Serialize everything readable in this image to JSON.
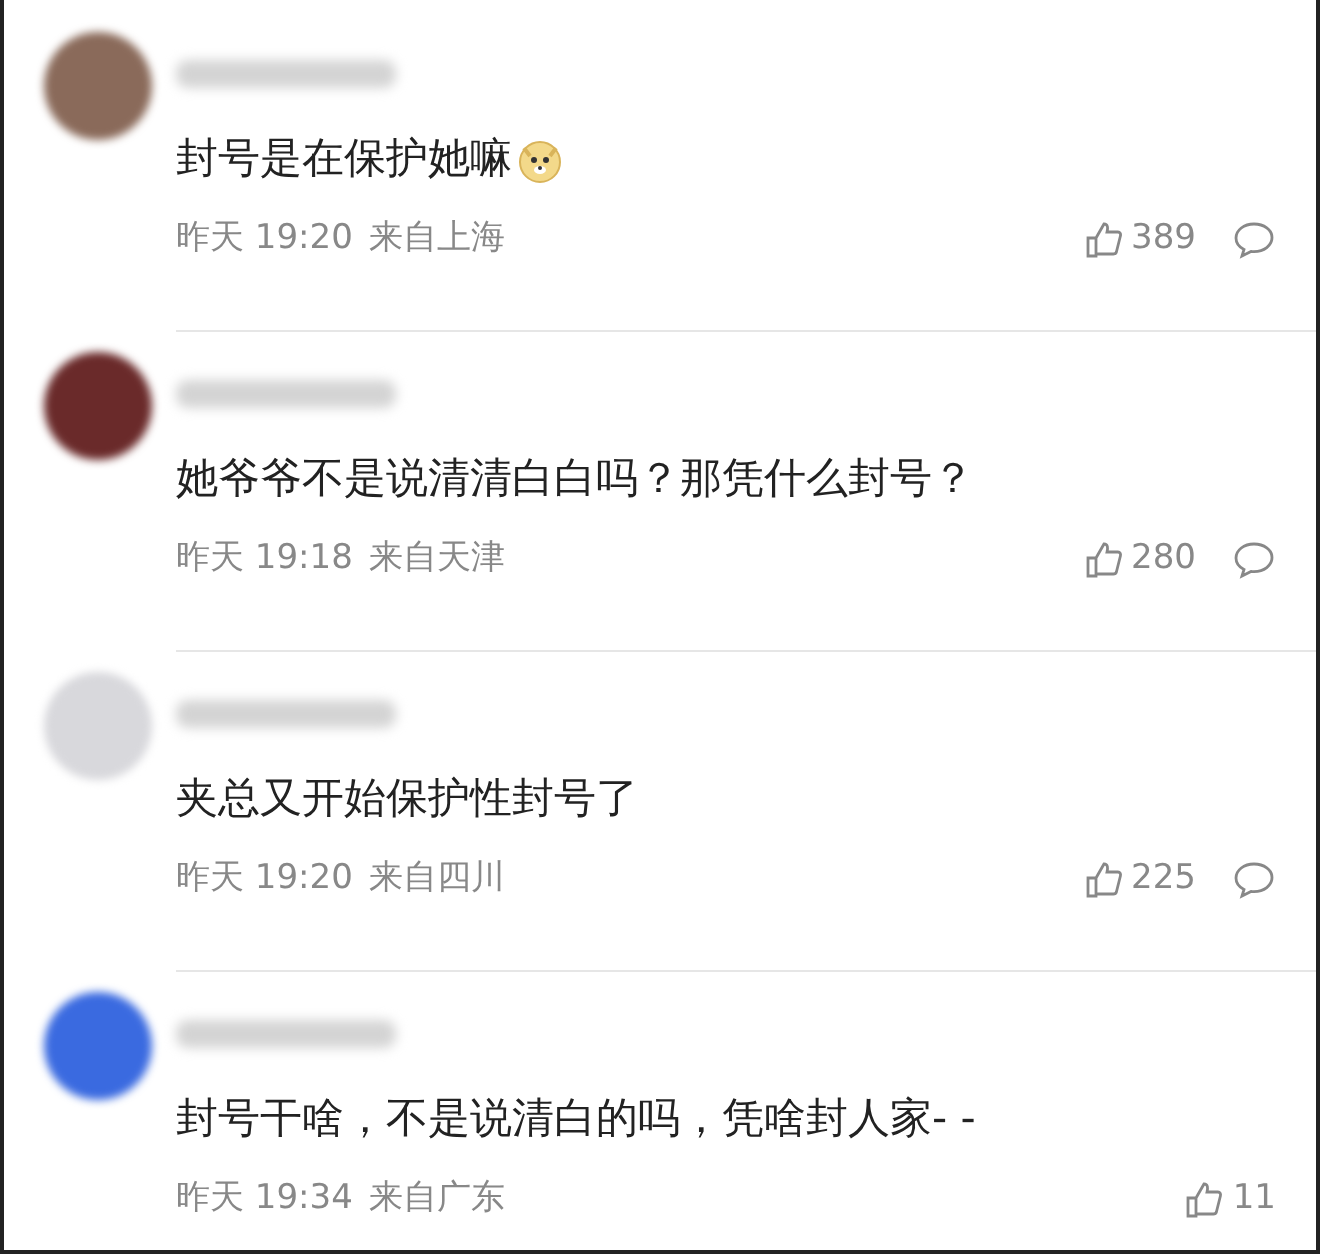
{
  "comments": [
    {
      "color": "#8a6a5a",
      "text": "封号是在保护她嘛",
      "emoji": true,
      "time": "昨天 19:20",
      "location": "来自上海",
      "likes": "389",
      "reply_icon": true
    },
    {
      "color": "#6a2a2a",
      "text": "她爷爷不是说清清白白吗？那凭什么封号？",
      "emoji": false,
      "time": "昨天 19:18",
      "location": "来自天津",
      "likes": "280",
      "reply_icon": true
    },
    {
      "color": "#d8d8dc",
      "text": "夹总又开始保护性封号了",
      "emoji": false,
      "time": "昨天 19:20",
      "location": "来自四川",
      "likes": "225",
      "reply_icon": true
    },
    {
      "color": "#3a6ae0",
      "text": "封号干啥，不是说清白的吗，凭啥封人家- -",
      "emoji": false,
      "time": "昨天 19:34",
      "location": "来自广东",
      "likes": "11",
      "reply_icon": false
    }
  ]
}
